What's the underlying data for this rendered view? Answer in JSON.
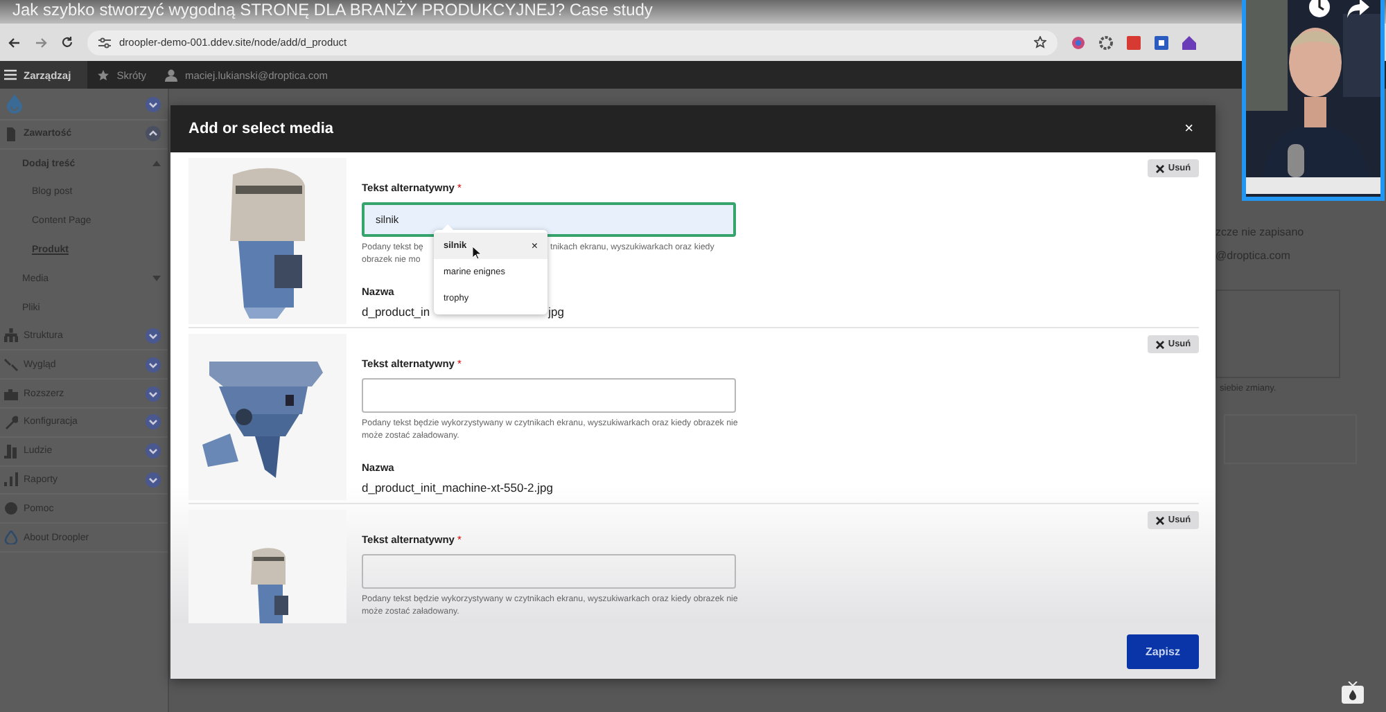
{
  "video": {
    "title": "Jak szybko stworzyć wygodną STRONĘ DLA BRANŻY PRODUKCYJNEJ? Case study"
  },
  "browser": {
    "url": "droopler-demo-001.ddev.site/node/add/d_product"
  },
  "toolbar": {
    "manage": "Zarządzaj",
    "shortcuts": "Skróty",
    "user": "maciej.lukianski@droptica.com"
  },
  "sidebar": {
    "items": [
      {
        "label": "Zawartość",
        "expanded": true,
        "selected": false,
        "children": [
          {
            "label": "Dodaj treść",
            "expanded": true,
            "selected": false,
            "children": [
              {
                "label": "Blog post",
                "selected": false
              },
              {
                "label": "Content Page",
                "selected": false
              },
              {
                "label": "Produkt",
                "selected": true
              }
            ]
          },
          {
            "label": "Media",
            "expanded": false,
            "selected": false
          },
          {
            "label": "Pliki",
            "selected": false
          }
        ]
      },
      {
        "label": "Struktura",
        "expanded": false,
        "selected": false
      },
      {
        "label": "Wygląd",
        "expanded": false,
        "selected": false
      },
      {
        "label": "Rozszerz",
        "expanded": false,
        "selected": false
      },
      {
        "label": "Konfiguracja",
        "expanded": false,
        "selected": false
      },
      {
        "label": "Ludzie",
        "expanded": false,
        "selected": false
      },
      {
        "label": "Raporty",
        "expanded": false,
        "selected": false
      },
      {
        "label": "Pomoc",
        "selected": false
      },
      {
        "label": "About Droopler",
        "selected": false
      }
    ]
  },
  "background": {
    "lines": [
      "zcze nie zapisano",
      "@droptica.com"
    ],
    "hint": "siebie zmiany."
  },
  "modal": {
    "title": "Add or select media",
    "close": "×",
    "save": "Zapisz",
    "media": [
      {
        "alt_label": "Tekst alternatywny",
        "required_mark": "*",
        "value": "silnik",
        "focused": true,
        "hint_left": [
          "Podany tekst bę",
          "obrazek nie mo"
        ],
        "hint_right": "tnikach ekranu, wyszukiwarkach oraz kiedy",
        "name_label": "Nazwa",
        "name_left": "d_product_in",
        "name_right": "jpg",
        "remove": "Usuń"
      },
      {
        "alt_label": "Tekst alternatywny",
        "required_mark": "*",
        "focused": false,
        "hint": "Podany tekst będzie wykorzystywany w czytnikach ekranu, wyszukiwarkach oraz kiedy obrazek nie może zostać załadowany.",
        "name_label": "Nazwa",
        "name": "d_product_init_machine-xt-550-2.jpg",
        "remove": "Usuń"
      },
      {
        "alt_label": "Tekst alternatywny",
        "required_mark": "*",
        "focused": false,
        "hint": "Podany tekst będzie wykorzystywany w czytnikach ekranu, wyszukiwarkach oraz kiedy obrazek nie może zostać załadowany.",
        "remove": "Usuń"
      }
    ],
    "autocomplete": [
      {
        "label": "silnik",
        "selected": true,
        "clear": "×"
      },
      {
        "label": "marine enignes",
        "selected": false
      },
      {
        "label": "trophy",
        "selected": false
      }
    ]
  }
}
